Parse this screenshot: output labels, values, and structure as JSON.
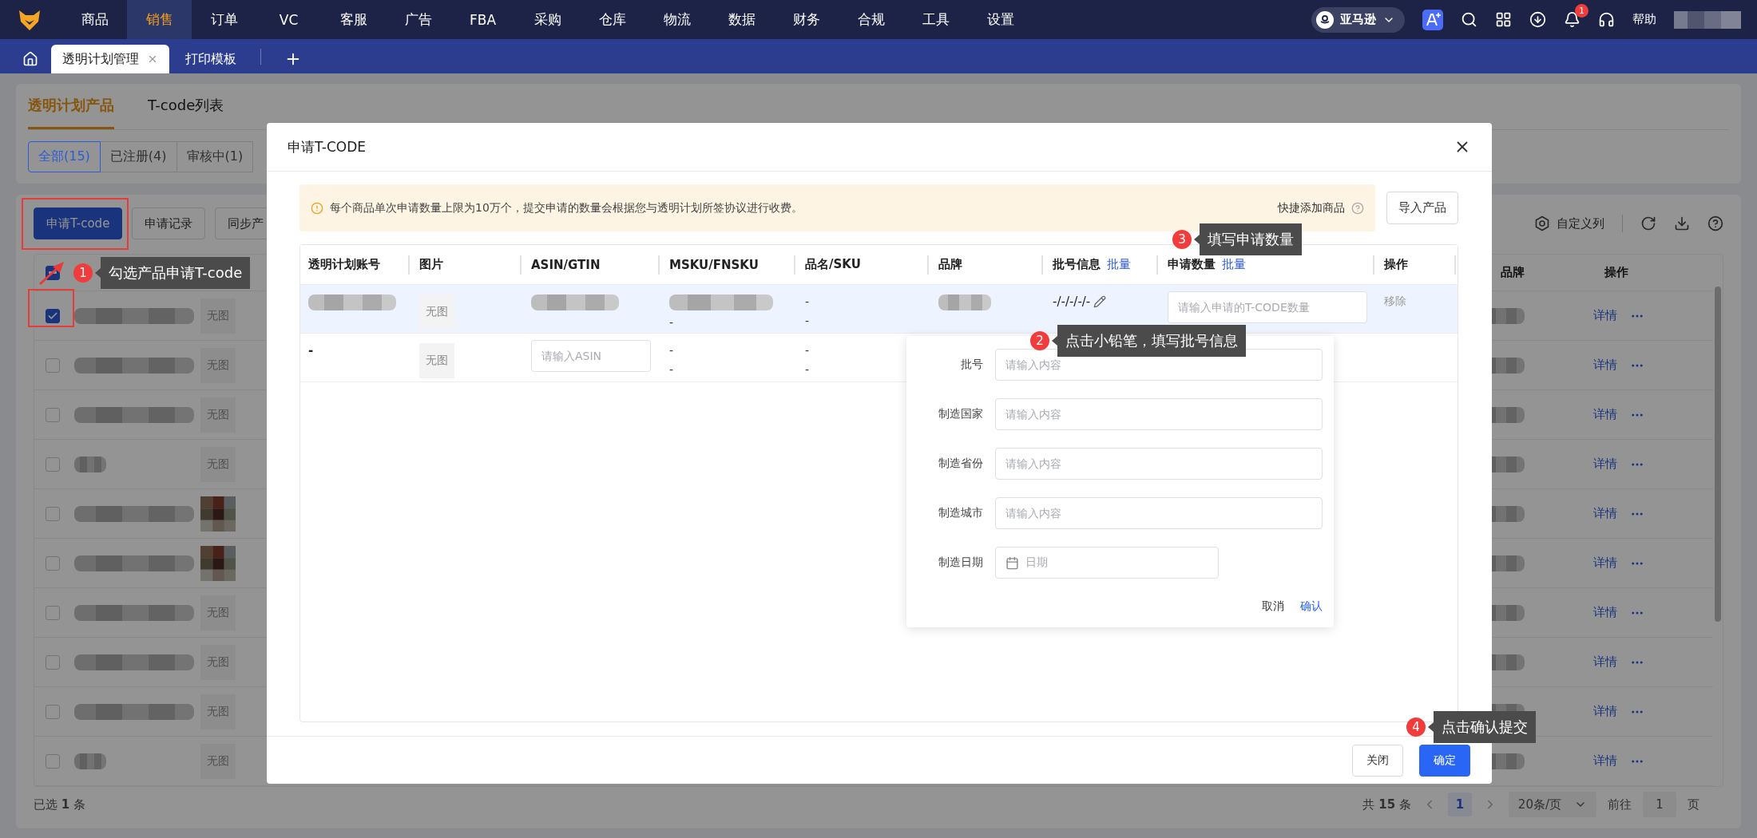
{
  "top_nav": {
    "items": [
      {
        "label": "商品",
        "selected": false
      },
      {
        "label": "销售",
        "selected": true
      },
      {
        "label": "订单",
        "selected": false
      },
      {
        "label": "VC",
        "selected": false
      },
      {
        "label": "客服",
        "selected": false
      },
      {
        "label": "广告",
        "selected": false
      },
      {
        "label": "FBA",
        "selected": false
      },
      {
        "label": "采购",
        "selected": false
      },
      {
        "label": "仓库",
        "selected": false
      },
      {
        "label": "物流",
        "selected": false
      },
      {
        "label": "数据",
        "selected": false
      },
      {
        "label": "财务",
        "selected": false
      },
      {
        "label": "合规",
        "selected": false
      },
      {
        "label": "工具",
        "selected": false
      },
      {
        "label": "设置",
        "selected": false
      }
    ],
    "platform": "亚马逊",
    "notification_count": "1",
    "help": "帮助"
  },
  "page_tabs": [
    {
      "label": "透明计划管理",
      "selected": true,
      "closable": true
    },
    {
      "label": "打印模板",
      "selected": false,
      "closable": false
    }
  ],
  "section_tabs": [
    {
      "label": "透明计划产品",
      "selected": true
    },
    {
      "label": "T-code列表",
      "selected": false
    }
  ],
  "filters": [
    {
      "label": "全部(15)",
      "selected": true
    },
    {
      "label": "已注册(4)",
      "selected": false
    },
    {
      "label": "审核中(1)",
      "selected": false
    }
  ],
  "toolbar": {
    "buttons": [
      {
        "label": "申请T-code",
        "kind": "primary"
      },
      {
        "label": "申请记录",
        "kind": "default"
      },
      {
        "label": "同步产",
        "kind": "default"
      }
    ],
    "custom_columns": "自定义列"
  },
  "product_table": {
    "header_indeterminate": true,
    "columns": [
      {
        "label": "品牌"
      },
      {
        "label": "操作"
      }
    ],
    "rows": [
      {
        "checked": true,
        "image": {
          "kind": "placeholder",
          "text": "无图"
        },
        "action": "详情"
      },
      {
        "checked": false,
        "image": {
          "kind": "placeholder",
          "text": "无图"
        },
        "action": "详情"
      },
      {
        "checked": false,
        "image": {
          "kind": "placeholder",
          "text": "无图"
        },
        "action": "详情"
      },
      {
        "checked": false,
        "image": {
          "kind": "placeholder",
          "text": "无图"
        },
        "action": "详情"
      },
      {
        "checked": false,
        "action": "详情"
      },
      {
        "checked": false,
        "action": "详情"
      },
      {
        "checked": false,
        "image": {
          "kind": "placeholder",
          "text": "无图"
        },
        "action": "详情"
      },
      {
        "checked": false,
        "image": {
          "kind": "placeholder",
          "text": "无图"
        },
        "action": "详情"
      },
      {
        "checked": false,
        "image": {
          "kind": "placeholder",
          "text": "无图"
        },
        "action": "详情"
      },
      {
        "checked": false,
        "image": {
          "kind": "placeholder",
          "text": "无图"
        },
        "action": "详情"
      }
    ]
  },
  "selection_summary": "已选 **1** 条",
  "pagination": {
    "total": "共 **15** 条",
    "pages": [
      {
        "label": "1",
        "selected": true
      }
    ],
    "page_size": "20条/页",
    "goto_label": "前往",
    "goto_value": "1",
    "goto_suffix": "页"
  },
  "modal": {
    "title": "申请T-CODE",
    "notice": "每个商品单次申请数量上限为10万个，提交申请的数量会根据您与透明计划所签协议进行收费。",
    "quick_add": "快捷添加商品",
    "import_button": "导入产品",
    "columns": [
      {
        "label": "透明计划账号"
      },
      {
        "label": "图片"
      },
      {
        "label": "ASIN/GTIN"
      },
      {
        "label": "MSKU/FNSKU"
      },
      {
        "label": "品名/SKU"
      },
      {
        "label": "品牌"
      },
      {
        "label": "批号信息",
        "link": "批量"
      },
      {
        "label": "申请数量",
        "link": "批量"
      },
      {
        "label": "操作"
      }
    ],
    "rows": [
      {
        "selected": true,
        "cells": [
          {
            "kind": "blurred"
          },
          {
            "kind": "thumb",
            "text": "无图"
          },
          {
            "kind": "blurred"
          },
          {
            "kind": "blurred_lines",
            "lines": [
              "-"
            ]
          },
          {
            "kind": "lines",
            "lines": [
              "-",
              "-"
            ]
          },
          {
            "kind": "blurred"
          },
          {
            "kind": "edit",
            "text": "-/-/-/-/-"
          },
          {
            "kind": "input",
            "placeholder": "请输入申请的T-CODE数量"
          },
          {
            "kind": "action",
            "text": "移除"
          }
        ]
      },
      {
        "selected": false,
        "cells": [
          {
            "kind": "text",
            "text": "-"
          },
          {
            "kind": "thumb",
            "text": "无图"
          },
          {
            "kind": "input",
            "placeholder": "请输入ASIN"
          },
          {
            "kind": "lines",
            "lines": [
              "-",
              "-"
            ]
          },
          {
            "kind": "lines",
            "lines": [
              "-",
              "-"
            ]
          }
        ]
      }
    ],
    "popover": {
      "fields": [
        {
          "label": "批号",
          "kind": "text",
          "placeholder": "请输入内容"
        },
        {
          "label": "制造国家",
          "kind": "text",
          "placeholder": "请输入内容"
        },
        {
          "label": "制造省份",
          "kind": "text",
          "placeholder": "请输入内容"
        },
        {
          "label": "制造城市",
          "kind": "text",
          "placeholder": "请输入内容"
        },
        {
          "label": "制造日期",
          "kind": "date",
          "placeholder": "日期"
        }
      ],
      "cancel": "取消",
      "confirm": "确认"
    },
    "close_button": "关闭",
    "ok_button": "确定"
  },
  "annotations": [
    {
      "number": "1",
      "text": "勾选产品申请T-code"
    },
    {
      "number": "2",
      "text": "点击小铅笔，填写批号信息"
    },
    {
      "number": "3",
      "text": "填写申请数量"
    },
    {
      "number": "4",
      "text": "点击确认提交"
    }
  ]
}
